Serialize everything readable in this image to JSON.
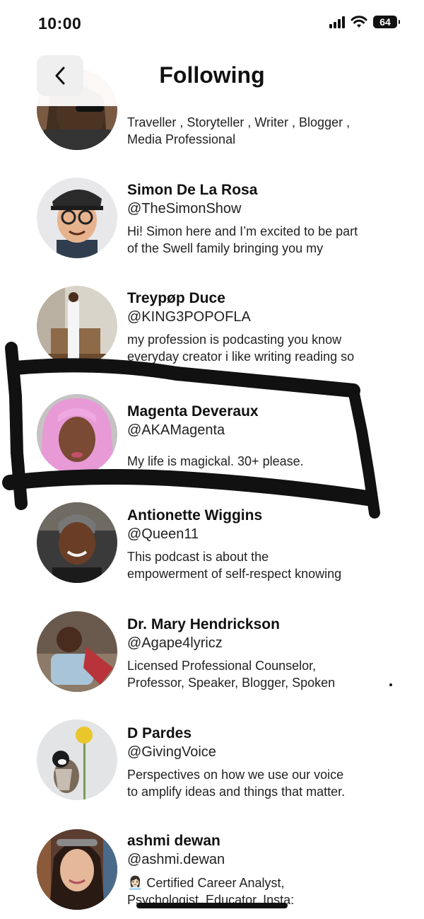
{
  "status_bar": {
    "time": "10:00",
    "battery": "64"
  },
  "header": {
    "title": "Following"
  },
  "users": [
    {
      "name": "",
      "handle": "",
      "bio": [
        "Traveller , Storyteller , Writer , Blogger ,",
        "Media Professional"
      ]
    },
    {
      "name": "Simon De La Rosa",
      "handle": "@TheSimonShow",
      "bio": [
        "Hi! Simon here and I’m excited to be part",
        "of the Swell family bringing you my"
      ]
    },
    {
      "name": "Treypøp Duce",
      "handle": "@KING3POPOFLA",
      "bio": [
        "my profession is podcasting you know",
        "everyday creator i like writing reading so"
      ]
    },
    {
      "name": "Magenta Deveraux",
      "handle": "@AKAMagenta",
      "bio": [
        "My life is magickal. 30+ please."
      ]
    },
    {
      "name": "Antionette Wiggins",
      "handle": "@Queen11",
      "bio": [
        " This podcast is about the",
        "empowerment of self-respect knowing"
      ]
    },
    {
      "name": "Dr. Mary Hendrickson",
      "handle": "@Agape4lyricz",
      "bio": [
        "Licensed Professional Counselor,",
        "Professor, Speaker, Blogger, Spoken"
      ]
    },
    {
      "name": "D Pardes",
      "handle": "@GivingVoice",
      "bio": [
        "Perspectives on how we use our voice",
        "to amplify ideas and things that matter."
      ]
    },
    {
      "name": "ashmi dewan",
      "handle": "@ashmi.dewan",
      "bio": [
        "👩🏻‍💼 Certified Career Analyst,",
        "Psychologist, Educator, Insta:"
      ]
    }
  ],
  "colors": {
    "annotation_ink": "#111111",
    "back_button_bg": "#efefef"
  },
  "icons": {
    "back": "chevron-left-icon",
    "signal": "signal-icon",
    "wifi": "wifi-icon",
    "battery": "battery-icon"
  }
}
